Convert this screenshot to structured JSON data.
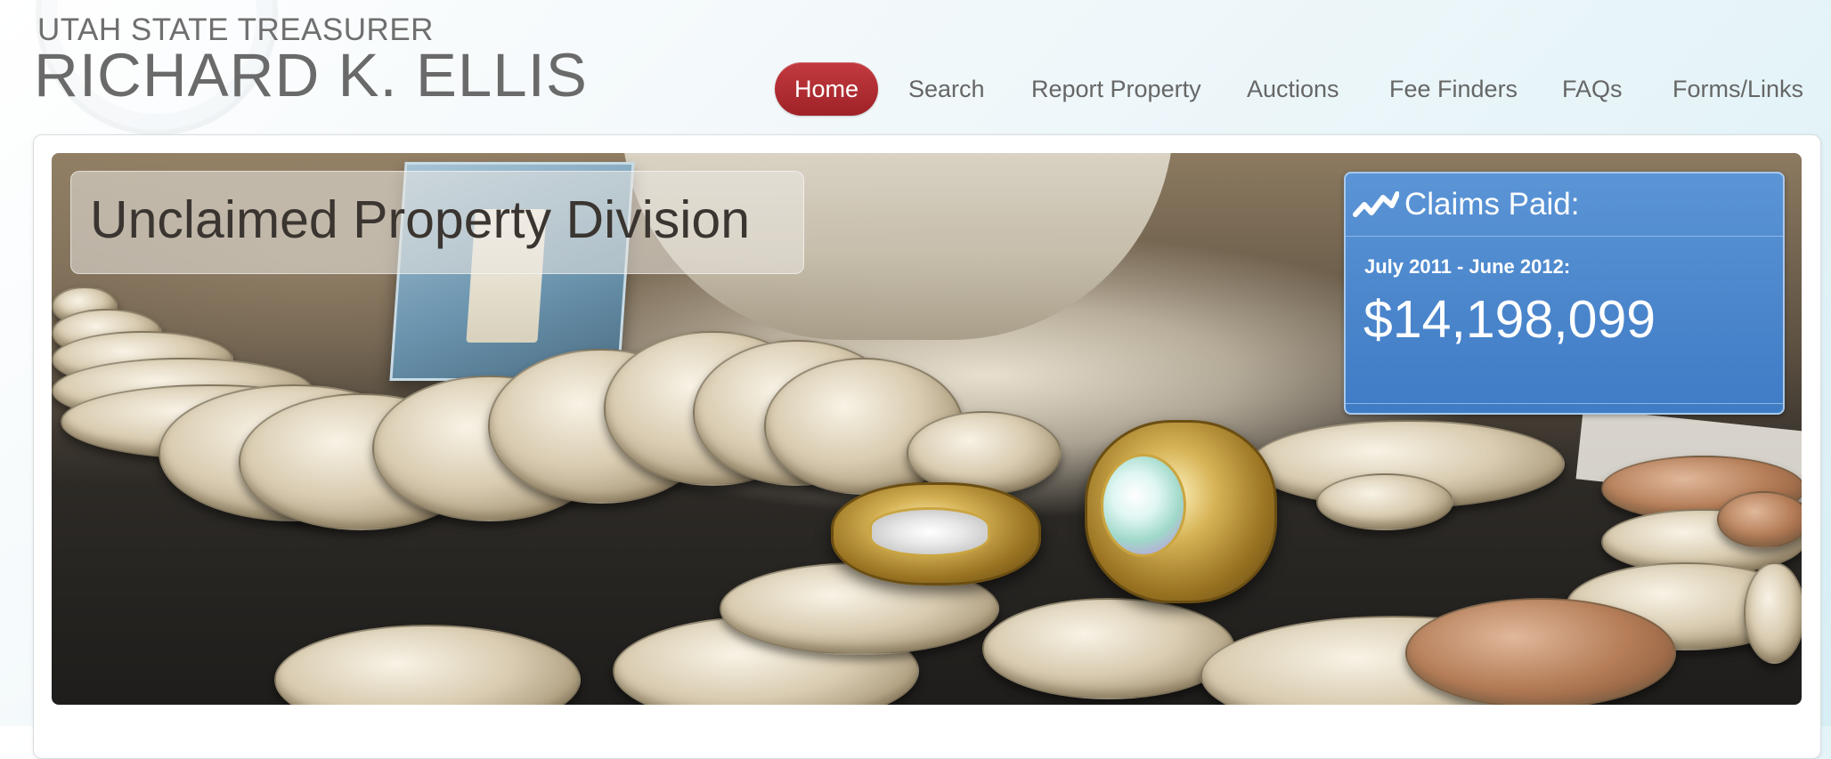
{
  "header": {
    "title_line": "UTAH STATE TREASURER",
    "name_line": "RICHARD K. ELLIS"
  },
  "nav": {
    "items": [
      {
        "label": "Home",
        "active": true
      },
      {
        "label": "Search",
        "active": false
      },
      {
        "label": "Report Property",
        "active": false
      },
      {
        "label": "Auctions",
        "active": false
      },
      {
        "label": "Fee Finders",
        "active": false
      },
      {
        "label": "FAQs",
        "active": false
      },
      {
        "label": "Forms/Links",
        "active": false
      }
    ]
  },
  "hero": {
    "title": "Unclaimed Property Division"
  },
  "claims": {
    "title": "Claims Paid:",
    "icon": "trend-chart-icon",
    "period": "July 2011 - June 2012:",
    "amount": "$14,198,099"
  },
  "colors": {
    "nav_active": "#b02d32",
    "claims_box": "#4b86cc",
    "nav_text": "#666666"
  }
}
